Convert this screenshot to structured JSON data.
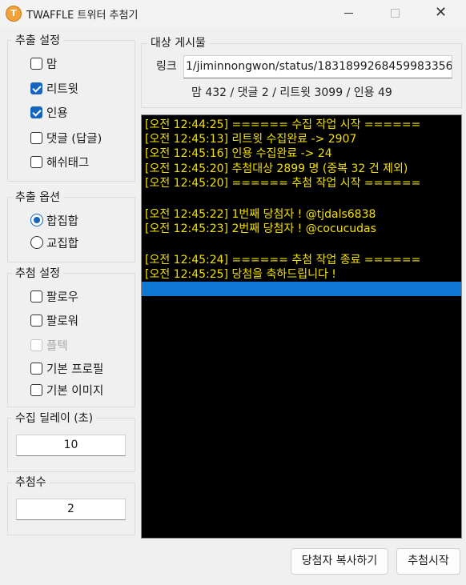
{
  "window": {
    "title": "TWAFFLE 트위터 추첨기",
    "app_icon_letter": "T",
    "close_glyph": "✕"
  },
  "extract_settings": {
    "label": "추출 설정",
    "options": [
      {
        "label": "맘",
        "checked": false
      },
      {
        "label": "리트윗",
        "checked": true
      },
      {
        "label": "인용",
        "checked": true
      },
      {
        "label": "댓글 (답글)",
        "checked": false
      },
      {
        "label": "해쉬태그",
        "checked": false
      }
    ]
  },
  "extract_option": {
    "label": "추출 옵션",
    "options": [
      {
        "label": "합집합",
        "selected": true
      },
      {
        "label": "교집합",
        "selected": false
      }
    ]
  },
  "draw_settings": {
    "label": "추첨 설정",
    "options": [
      {
        "label": "팔로우",
        "checked": false,
        "disabled": false
      },
      {
        "label": "팔로워",
        "checked": false,
        "disabled": false
      },
      {
        "label": "플텍",
        "checked": false,
        "disabled": true
      },
      {
        "label": "기본 프로필",
        "checked": false,
        "disabled": false
      },
      {
        "label": "기본 이미지",
        "checked": false,
        "disabled": false
      }
    ]
  },
  "delay": {
    "label": "수집 딜레이 (초)",
    "value": "10"
  },
  "winners": {
    "label": "추첨수",
    "value": "2"
  },
  "target_post": {
    "label": "대상 게시물",
    "link_label": "링크",
    "link_value": "1/jiminnongwon/status/1831899268459983356",
    "stats": "맘 432 / 댓글 2 / 리트윗 3099 / 인용 49"
  },
  "log": {
    "lines": [
      "[오전 12:44:25] ====== 수집 작업 시작 ======",
      "[오전 12:45:13] 리트윗 수집완료 -> 2907",
      "[오전 12:45:16] 인용 수집완료 -> 24",
      "[오전 12:45:20] 추첨대상 2899 명 (중복 32 건 제외)",
      "[오전 12:45:20] ====== 추첨 작업 시작 ======",
      "",
      "[오전 12:45:22] 1번째 당첨자 ! @tjdals6838",
      "[오전 12:45:23] 2번째 당첨자 ! @cocucudas",
      "",
      "[오전 12:45:24] ====== 추첨 작업 종료 ======",
      "[오전 12:45:25] 당첨을 축하드립니다 !"
    ],
    "text_color": "#f3e000",
    "highlight_color": "#0f78d4"
  },
  "buttons": {
    "copy_winners": "당첨자 복사하기",
    "start_draw": "추첨시작"
  }
}
